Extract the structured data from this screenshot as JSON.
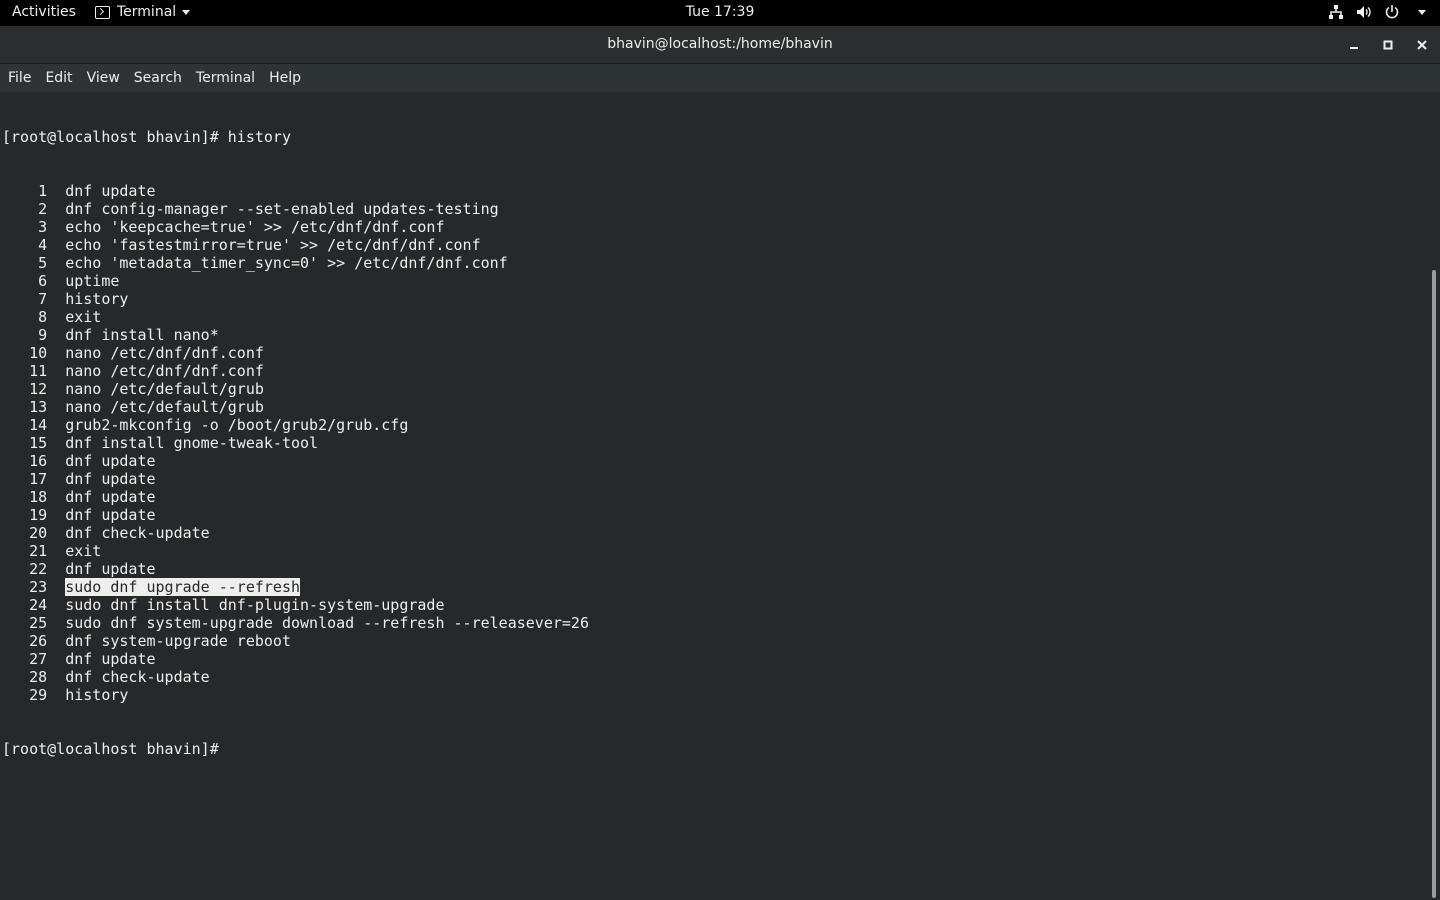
{
  "topbar": {
    "activities": "Activities",
    "app_name": "Terminal",
    "clock": "Tue 17:39",
    "icons": [
      "network-icon",
      "volume-icon",
      "power-icon",
      "chevron-down-icon"
    ]
  },
  "window": {
    "title": "bhavin@localhost:/home/bhavin",
    "buttons": [
      "minimize-icon",
      "maximize-icon",
      "close-icon"
    ]
  },
  "menu": [
    "File",
    "Edit",
    "View",
    "Search",
    "Terminal",
    "Help"
  ],
  "terminal": {
    "prompt": "[root@localhost bhavin]#",
    "command": "history",
    "history": [
      {
        "num": "1",
        "cmd": "dnf update"
      },
      {
        "num": "2",
        "cmd": "dnf config-manager --set-enabled updates-testing"
      },
      {
        "num": "3",
        "cmd": "echo 'keepcache=true' >> /etc/dnf/dnf.conf"
      },
      {
        "num": "4",
        "cmd": "echo 'fastestmirror=true' >> /etc/dnf/dnf.conf"
      },
      {
        "num": "5",
        "cmd": "echo 'metadata_timer_sync=0' >> /etc/dnf/dnf.conf"
      },
      {
        "num": "6",
        "cmd": "uptime"
      },
      {
        "num": "7",
        "cmd": "history"
      },
      {
        "num": "8",
        "cmd": "exit"
      },
      {
        "num": "9",
        "cmd": "dnf install nano*"
      },
      {
        "num": "10",
        "cmd": "nano /etc/dnf/dnf.conf"
      },
      {
        "num": "11",
        "cmd": "nano /etc/dnf/dnf.conf"
      },
      {
        "num": "12",
        "cmd": "nano /etc/default/grub"
      },
      {
        "num": "13",
        "cmd": "nano /etc/default/grub"
      },
      {
        "num": "14",
        "cmd": "grub2-mkconfig -o /boot/grub2/grub.cfg"
      },
      {
        "num": "15",
        "cmd": "dnf install gnome-tweak-tool"
      },
      {
        "num": "16",
        "cmd": "dnf update"
      },
      {
        "num": "17",
        "cmd": "dnf update"
      },
      {
        "num": "18",
        "cmd": "dnf update"
      },
      {
        "num": "19",
        "cmd": "dnf update"
      },
      {
        "num": "20",
        "cmd": "dnf check-update"
      },
      {
        "num": "21",
        "cmd": "exit"
      },
      {
        "num": "22",
        "cmd": "dnf update"
      },
      {
        "num": "23",
        "cmd": "sudo dnf upgrade --refresh",
        "selected": true
      },
      {
        "num": "24",
        "cmd": "sudo dnf install dnf-plugin-system-upgrade"
      },
      {
        "num": "25",
        "cmd": "sudo dnf system-upgrade download --refresh --releasever=26"
      },
      {
        "num": "26",
        "cmd": "dnf system-upgrade reboot"
      },
      {
        "num": "27",
        "cmd": "dnf update"
      },
      {
        "num": "28",
        "cmd": "dnf check-update"
      },
      {
        "num": "29",
        "cmd": "history"
      }
    ],
    "final_prompt": "[root@localhost bhavin]#"
  },
  "colors": {
    "terminal_bg": "#25292b",
    "terminal_fg": "#eeeeec",
    "menubar_bg": "#2e3436",
    "headerbar_bg": "#2b2e2f"
  }
}
